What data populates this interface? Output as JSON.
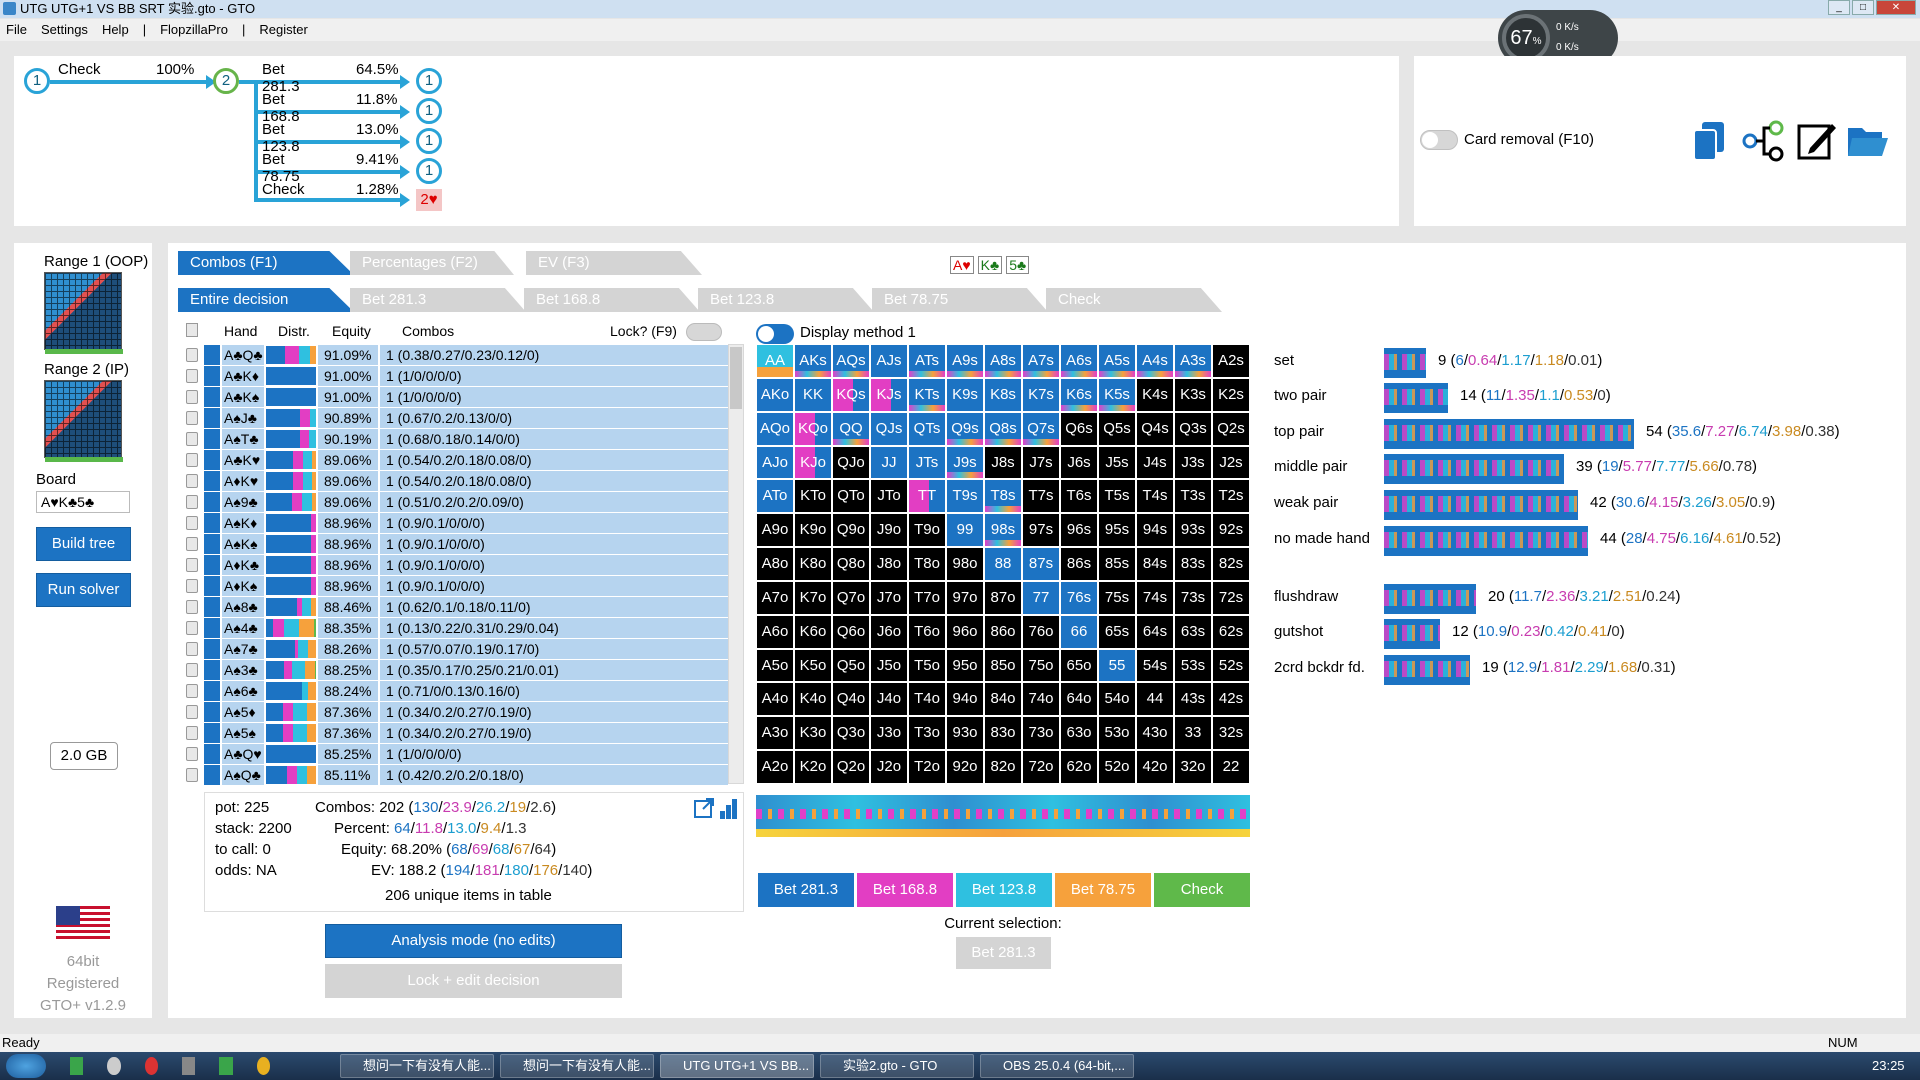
{
  "window": {
    "title": "UTG UTG+1 VS BB SRT 实验.gto - GTO"
  },
  "menu": [
    "File",
    "Settings",
    "Help",
    "|",
    "FlopzillaPro",
    "|",
    "Register"
  ],
  "net": {
    "cpu": "67",
    "unit": "%",
    "up": "0 K/s",
    "down": "0 K/s"
  },
  "tree": {
    "root_node": "1",
    "check_label": "Check",
    "check_pct": "100%",
    "mid_node": "2",
    "branches": [
      {
        "label": "Bet 281.3",
        "pct": "64.5%",
        "node": "1"
      },
      {
        "label": "Bet 168.8",
        "pct": "11.8%",
        "node": "1"
      },
      {
        "label": "Bet 123.8",
        "pct": "13.0%",
        "node": "1"
      },
      {
        "label": "Bet 78.75",
        "pct": "9.41%",
        "node": "1"
      },
      {
        "label": "Check",
        "pct": "1.28%",
        "node": "2♥"
      }
    ]
  },
  "card_removal": "Card removal (F10)",
  "left": {
    "range1": "Range 1 (OOP)",
    "range2": "Range 2 (IP)",
    "board_label": "Board",
    "board_value": "A♥K♣5♣",
    "build": "Build tree",
    "run": "Run solver",
    "memory": "2.0 GB",
    "bits": "64bit",
    "registered": "Registered",
    "version": "GTO+ v1.2.9"
  },
  "tabs1": [
    "Combos (F1)",
    "Percentages (F2)",
    "EV (F3)"
  ],
  "board_cards": [
    "A♥",
    "K♣",
    "5♣"
  ],
  "tabs2": [
    "Entire decision",
    "Bet 281.3",
    "Bet 168.8",
    "Bet 123.8",
    "Bet 78.75",
    "Check"
  ],
  "table": {
    "headers": {
      "hand": "Hand",
      "distr": "Distr.",
      "equity": "Equity",
      "combos": "Combos",
      "lock": "Lock? (F9)"
    },
    "rows": [
      {
        "hand": "A♣Q♣",
        "eq": "91.09%",
        "combo": "1 (0.38/0.27/0.23/0.12/0)"
      },
      {
        "hand": "A♣K♦",
        "eq": "91.00%",
        "combo": "1 (1/0/0/0/0)"
      },
      {
        "hand": "A♣K♠",
        "eq": "91.00%",
        "combo": "1 (1/0/0/0/0)"
      },
      {
        "hand": "A♠J♣",
        "eq": "90.89%",
        "combo": "1 (0.67/0.2/0.13/0/0)"
      },
      {
        "hand": "A♠T♣",
        "eq": "90.19%",
        "combo": "1 (0.68/0.18/0.14/0/0)"
      },
      {
        "hand": "A♣K♥",
        "eq": "89.06%",
        "combo": "1 (0.54/0.2/0.18/0.08/0)"
      },
      {
        "hand": "A♦K♥",
        "eq": "89.06%",
        "combo": "1 (0.54/0.2/0.18/0.08/0)"
      },
      {
        "hand": "A♠9♣",
        "eq": "89.06%",
        "combo": "1 (0.51/0.2/0.2/0.09/0)"
      },
      {
        "hand": "A♠K♦",
        "eq": "88.96%",
        "combo": "1 (0.9/0.1/0/0/0)"
      },
      {
        "hand": "A♠K♠",
        "eq": "88.96%",
        "combo": "1 (0.9/0.1/0/0/0)"
      },
      {
        "hand": "A♦K♣",
        "eq": "88.96%",
        "combo": "1 (0.9/0.1/0/0/0)"
      },
      {
        "hand": "A♦K♠",
        "eq": "88.96%",
        "combo": "1 (0.9/0.1/0/0/0)"
      },
      {
        "hand": "A♠8♣",
        "eq": "88.46%",
        "combo": "1 (0.62/0.1/0.18/0.11/0)"
      },
      {
        "hand": "A♠4♣",
        "eq": "88.35%",
        "combo": "1 (0.13/0.22/0.31/0.29/0.04)"
      },
      {
        "hand": "A♠7♣",
        "eq": "88.26%",
        "combo": "1 (0.57/0.07/0.19/0.17/0)"
      },
      {
        "hand": "A♠3♣",
        "eq": "88.25%",
        "combo": "1 (0.35/0.17/0.25/0.21/0.01)"
      },
      {
        "hand": "A♠6♣",
        "eq": "88.24%",
        "combo": "1 (0.71/0/0.13/0.16/0)"
      },
      {
        "hand": "A♠5♦",
        "eq": "87.36%",
        "combo": "1 (0.34/0.2/0.27/0.19/0)"
      },
      {
        "hand": "A♠5♠",
        "eq": "87.36%",
        "combo": "1 (0.34/0.2/0.27/0.19/0)"
      },
      {
        "hand": "A♣Q♥",
        "eq": "85.25%",
        "combo": "1 (1/0/0/0/0)"
      },
      {
        "hand": "A♠Q♣",
        "eq": "85.11%",
        "combo": "1 (0.42/0.2/0.2/0.18/0)"
      }
    ]
  },
  "display_method": "Display method 1",
  "grid": [
    [
      "AA",
      "AKs",
      "AQs",
      "AJs",
      "ATs",
      "A9s",
      "A8s",
      "A7s",
      "A6s",
      "A5s",
      "A4s",
      "A3s",
      "A2s"
    ],
    [
      "AKo",
      "KK",
      "KQs",
      "KJs",
      "KTs",
      "K9s",
      "K8s",
      "K7s",
      "K6s",
      "K5s",
      "K4s",
      "K3s",
      "K2s"
    ],
    [
      "AQo",
      "KQo",
      "QQ",
      "QJs",
      "QTs",
      "Q9s",
      "Q8s",
      "Q7s",
      "Q6s",
      "Q5s",
      "Q4s",
      "Q3s",
      "Q2s"
    ],
    [
      "AJo",
      "KJo",
      "QJo",
      "JJ",
      "JTs",
      "J9s",
      "J8s",
      "J7s",
      "J6s",
      "J5s",
      "J4s",
      "J3s",
      "J2s"
    ],
    [
      "ATo",
      "KTo",
      "QTo",
      "JTo",
      "TT",
      "T9s",
      "T8s",
      "T7s",
      "T6s",
      "T5s",
      "T4s",
      "T3s",
      "T2s"
    ],
    [
      "A9o",
      "K9o",
      "Q9o",
      "J9o",
      "T9o",
      "99",
      "98s",
      "97s",
      "96s",
      "95s",
      "94s",
      "93s",
      "92s"
    ],
    [
      "A8o",
      "K8o",
      "Q8o",
      "J8o",
      "T8o",
      "98o",
      "88",
      "87s",
      "86s",
      "85s",
      "84s",
      "83s",
      "82s"
    ],
    [
      "A7o",
      "K7o",
      "Q7o",
      "J7o",
      "T7o",
      "97o",
      "87o",
      "77",
      "76s",
      "75s",
      "74s",
      "73s",
      "72s"
    ],
    [
      "A6o",
      "K6o",
      "Q6o",
      "J6o",
      "T6o",
      "96o",
      "86o",
      "76o",
      "66",
      "65s",
      "64s",
      "63s",
      "62s"
    ],
    [
      "A5o",
      "K5o",
      "Q5o",
      "J5o",
      "T5o",
      "95o",
      "85o",
      "75o",
      "65o",
      "55",
      "54s",
      "53s",
      "52s"
    ],
    [
      "A4o",
      "K4o",
      "Q4o",
      "J4o",
      "T4o",
      "94o",
      "84o",
      "74o",
      "64o",
      "54o",
      "44",
      "43s",
      "42s"
    ],
    [
      "A3o",
      "K3o",
      "Q3o",
      "J3o",
      "T3o",
      "93o",
      "83o",
      "73o",
      "63o",
      "53o",
      "43o",
      "33",
      "32s"
    ],
    [
      "A2o",
      "K2o",
      "Q2o",
      "J2o",
      "T2o",
      "92o",
      "82o",
      "72o",
      "62o",
      "52o",
      "42o",
      "32o",
      "22"
    ]
  ],
  "info": {
    "pot": "pot: 225",
    "stack": "stack: 2200",
    "tocall": "to call: 0",
    "odds": "odds: NA",
    "combos_label": "Combos:",
    "combos": [
      "202 (",
      "130",
      "/",
      "23.9",
      "/",
      "26.2",
      "/",
      "19",
      "/",
      "2.6",
      ")"
    ],
    "percent_label": "Percent:",
    "percent": [
      "64",
      "/",
      "11.8",
      "/",
      "13.0",
      "/",
      "9.4",
      "/",
      "1.3"
    ],
    "equity_label": "Equity:",
    "equity": [
      "68.20% (",
      "68",
      "/",
      "69",
      "/",
      "68",
      "/",
      "67",
      "/",
      "64",
      ")"
    ],
    "ev_label": "EV:",
    "ev": [
      "188.2 (",
      "194",
      "/",
      "181",
      "/",
      "180",
      "/",
      "176",
      "/",
      "140",
      ")"
    ],
    "unique": "206 unique items in table"
  },
  "mode_btn": "Analysis mode (no edits)",
  "lock_btn": "Lock + edit decision",
  "actions": [
    {
      "label": "Bet 281.3",
      "color": "#1c73c3"
    },
    {
      "label": "Bet 168.8",
      "color": "#e23ec3"
    },
    {
      "label": "Bet 123.8",
      "color": "#2fc0e0"
    },
    {
      "label": "Bet 78.75",
      "color": "#f6a13c"
    },
    {
      "label": "Check",
      "color": "#5fb94a"
    }
  ],
  "current_selection": "Current selection:",
  "current_value": "Bet 281.3",
  "stats": [
    {
      "label": "set",
      "total": "9",
      "parts": [
        "6",
        "0.64",
        "1.17",
        "1.18",
        "0.01"
      ]
    },
    {
      "label": "two pair",
      "total": "14",
      "parts": [
        "11",
        "1.35",
        "1.1",
        "0.53",
        "0"
      ]
    },
    {
      "label": "top pair",
      "total": "54",
      "parts": [
        "35.6",
        "7.27",
        "6.74",
        "3.98",
        "0.38"
      ]
    },
    {
      "label": "middle pair",
      "total": "39",
      "parts": [
        "19",
        "5.77",
        "7.77",
        "5.66",
        "0.78"
      ]
    },
    {
      "label": "weak pair",
      "total": "42",
      "parts": [
        "30.6",
        "4.15",
        "3.26",
        "3.05",
        "0.9"
      ]
    },
    {
      "label": "no made hand",
      "total": "44",
      "parts": [
        "28",
        "4.75",
        "6.16",
        "4.61",
        "0.52"
      ]
    },
    {
      "label": "flushdraw",
      "total": "20",
      "parts": [
        "11.7",
        "2.36",
        "3.21",
        "2.51",
        "0.24"
      ]
    },
    {
      "label": "gutshot",
      "total": "12",
      "parts": [
        "10.9",
        "0.23",
        "0.42",
        "0.41",
        "0"
      ]
    },
    {
      "label": "2crd bckdr fd.",
      "total": "19",
      "parts": [
        "12.9",
        "1.81",
        "2.29",
        "1.68",
        "0.31"
      ]
    }
  ],
  "status": {
    "ready": "Ready",
    "num": "NUM"
  },
  "taskbar": {
    "items": [
      "想问一下有没有人能...",
      "想问一下有没有人能...",
      "UTG UTG+1 VS BB...",
      "实验2.gto - GTO",
      "OBS 25.0.4 (64-bit,..."
    ],
    "time": "23:25"
  }
}
